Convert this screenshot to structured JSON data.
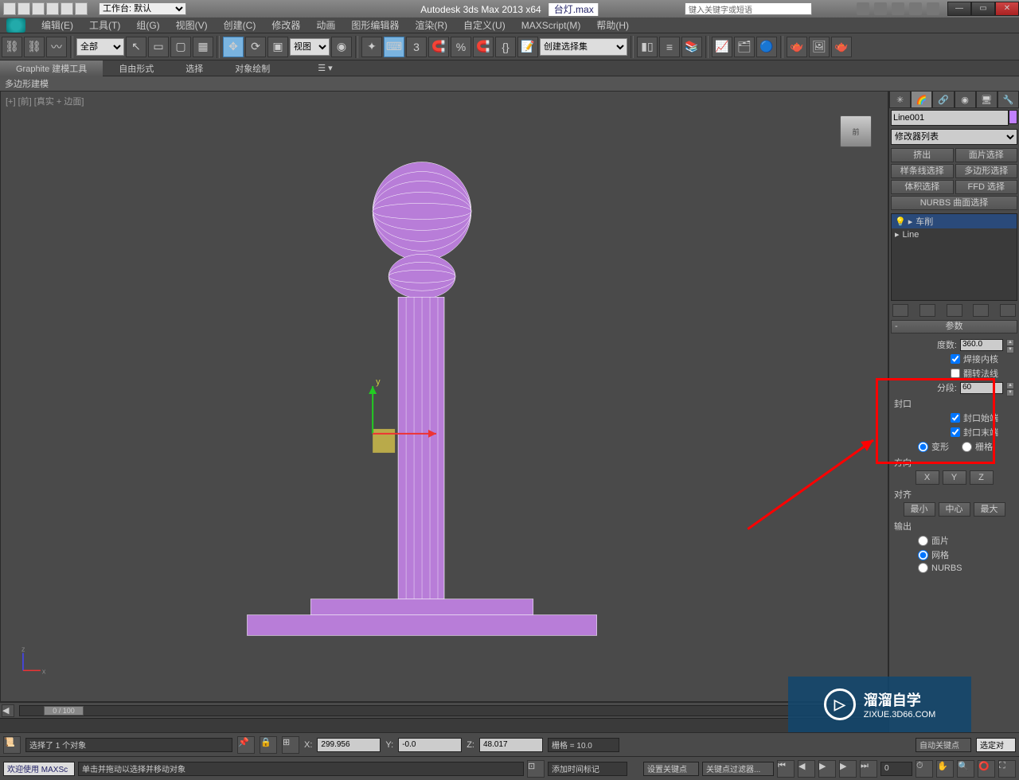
{
  "titlebar": {
    "workspace_label": "工作台: 默认",
    "app_title": "Autodesk 3ds Max  2013 x64",
    "file_name": "台灯.max",
    "search_placeholder": "键入关键字或短语",
    "min": "—",
    "restore": "▭",
    "close": "✕"
  },
  "menu": {
    "edit": "编辑(E)",
    "tools": "工具(T)",
    "group": "组(G)",
    "views": "视图(V)",
    "create": "创建(C)",
    "modifiers": "修改器",
    "animation": "动画",
    "graph": "图形编辑器",
    "render": "渲染(R)",
    "customize": "自定义(U)",
    "maxscript": "MAXScript(M)",
    "help": "帮助(H)"
  },
  "toolbar": {
    "filter_all": "全部",
    "view_dd": "视图",
    "named_sel": "创建选择集"
  },
  "ribbon": {
    "graphite": "Graphite 建模工具",
    "freeform": "自由形式",
    "selection": "选择",
    "paint": "对象绘制",
    "poly": "多边形建模"
  },
  "viewport": {
    "label": "[+] [前] [真实 + 边面]",
    "cube": "前",
    "axis_y": "y",
    "axis_x": "x"
  },
  "panel": {
    "obj_name": "Line001",
    "modlist": "修改器列表",
    "btns": {
      "extrude": "挤出",
      "face": "面片选择",
      "spline": "样条线选择",
      "poly": "多边形选择",
      "vol": "体积选择",
      "ffd": "FFD 选择",
      "nurbs": "NURBS 曲面选择"
    },
    "stack": {
      "lathe": "车削",
      "line": "Line"
    },
    "rollout_params": "参数",
    "degrees_lbl": "度数:",
    "degrees_val": "360.0",
    "weld": "焊接内核",
    "flip": "翻转法线",
    "segments_lbl": "分段:",
    "segments_val": "60",
    "cap_hdr": "封口",
    "cap_start": "封口始端",
    "cap_end": "封口末端",
    "morph": "变形",
    "grid": "栅格",
    "direction": "方向",
    "align": "对齐",
    "align_min": "最小",
    "align_center": "中心",
    "align_max": "最大",
    "output": "输出",
    "out_patch": "面片",
    "out_mesh": "网格",
    "out_nurbs": "NURBS"
  },
  "timeline": {
    "frame": "0 / 100"
  },
  "status": {
    "sel": "选择了 1 个对象",
    "x_lbl": "X:",
    "x": "299.956",
    "y_lbl": "Y:",
    "y": "-0.0",
    "z_lbl": "Z:",
    "z": "48.017",
    "grid": "栅格 = 10.0",
    "autokey": "自动关键点",
    "selkey": "选定对",
    "welcome": "欢迎使用  MAXSc",
    "prompt": "单击并拖动以选择并移动对象",
    "addtime": "添加时间标记",
    "setkey": "设置关键点",
    "keyfilter": "关键点过滤器..."
  },
  "watermark": {
    "main": "溜溜自学",
    "sub": "ZIXUE.3D66.COM"
  }
}
